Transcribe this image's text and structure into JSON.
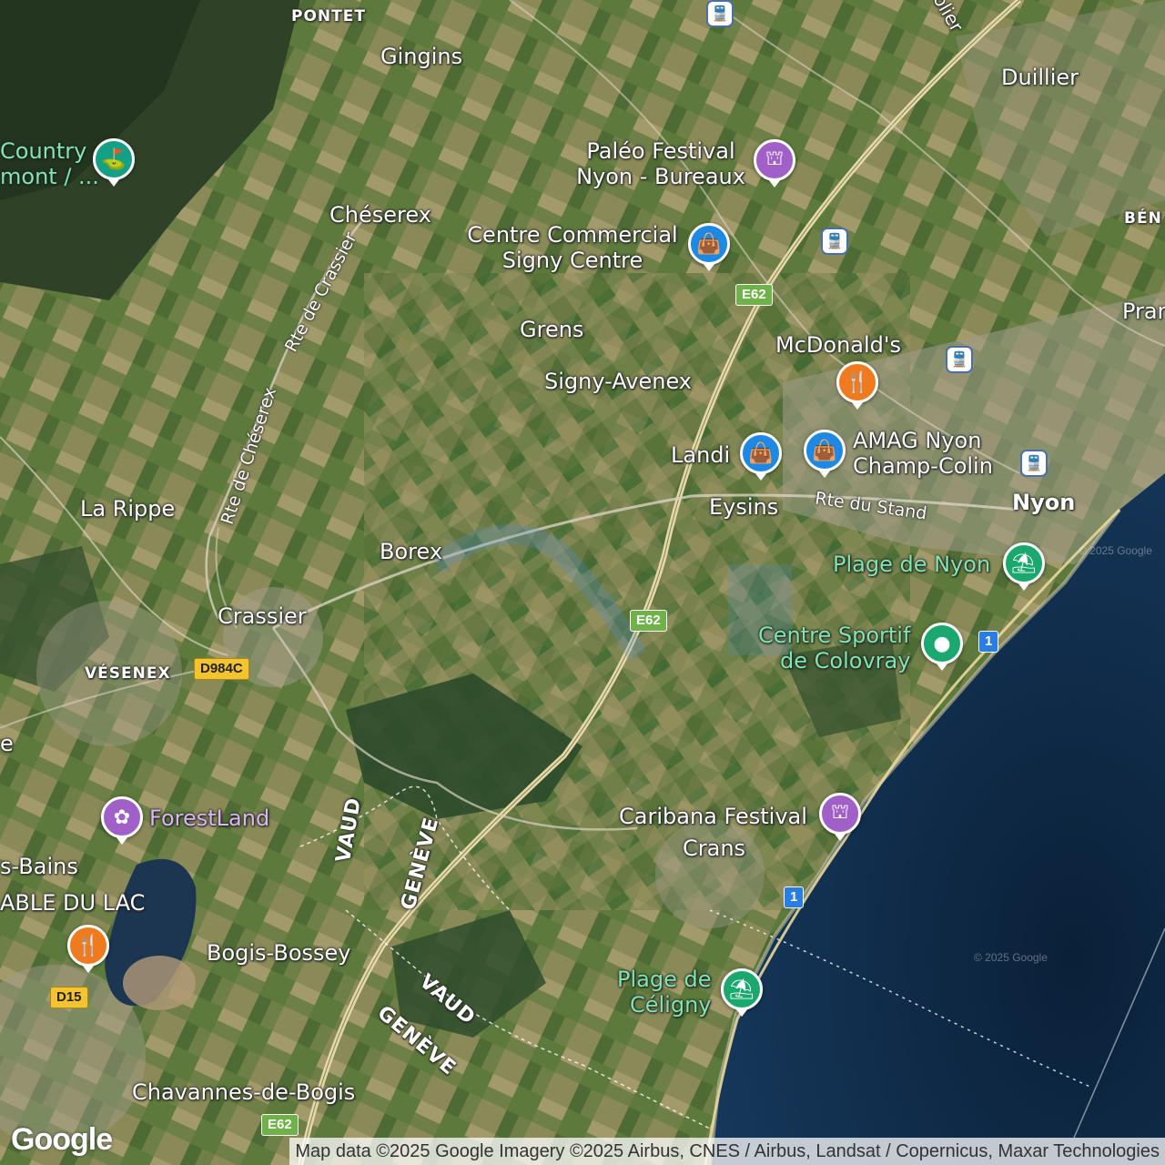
{
  "map": {
    "type": "satellite",
    "colors": {
      "lake": "#0f2a4a",
      "fields": "#6b7d45",
      "forest": "#2e4a2a",
      "urban": "#9a9a8a"
    }
  },
  "places": {
    "pontet": "PONTET",
    "gingins": "Gingins",
    "duillier": "Duillier",
    "country_club": "Country\nmont / ...",
    "cheserex": "Chéserex",
    "grens": "Grens",
    "signy_avenex": "Signy-Avenex",
    "la_rippe": "La Rippe",
    "borex": "Borex",
    "crassier": "Crassier",
    "vesenex": "VÉSENEX",
    "eysins": "Eysins",
    "nyon": "Nyon",
    "crans": "Crans",
    "bogis_bossey": "Bogis-Bossey",
    "chavannes": "Chavannes-de-Bogis",
    "bains": "s-Bains",
    "able_du_lac": "ABLE DU LAC",
    "ben": "BÉN",
    "pran": "Pran",
    "e_frag": "e",
    "vaud_1": "VAUD",
    "geneve_1": "GENÈVE",
    "vaud_2": "VAUD",
    "geneve_2": "GENÈVE",
    "olier": "olier"
  },
  "pois": {
    "paleo": "Paléo Festival\nNyon - Bureaux",
    "signy_centre": "Centre Commercial\nSigny Centre",
    "mcdonalds": "McDonald's",
    "landi": "Landi",
    "amag": "AMAG Nyon\nChamp-Colin",
    "plage_nyon": "Plage de Nyon",
    "colovray": "Centre Sportif\nde Colovray",
    "caribana": "Caribana Festival",
    "forestland": "ForestLand",
    "plage_celigny": "Plage de\nCéligny"
  },
  "roads": {
    "rte_cheserex_1": "Rte de Chéserex",
    "rte_cheserex_2": "Rte de Crassier",
    "rte_stand": "Rte du Stand",
    "e62": "E62",
    "d984c": "D984C",
    "d15": "D15",
    "r1": "1"
  },
  "icons": {
    "golf": "golf-icon",
    "monument": "monument-icon",
    "shopping": "shopping-bag-icon",
    "restaurant": "restaurant-icon",
    "beach": "beach-umbrella-icon",
    "sport": "sport-pin-icon",
    "theme_park": "theme-park-icon",
    "train": "train-icon"
  },
  "branding": {
    "google": "Google",
    "attribution": "Map data ©2025 Google Imagery ©2025 Airbus, CNES / Airbus, Landsat / Copernicus, Maxar Technologies",
    "watermark": "© 2025 Google"
  }
}
